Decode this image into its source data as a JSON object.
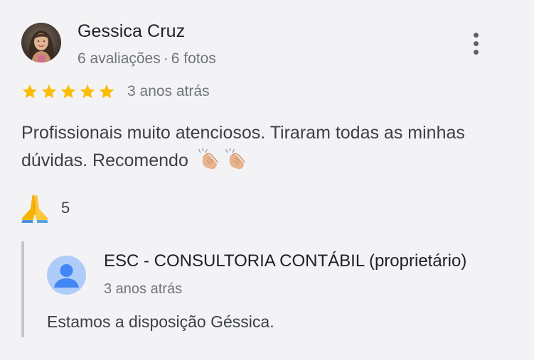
{
  "review": {
    "author": {
      "name": "Gessica Cruz",
      "reviews_count": "6 avaliações",
      "separator": "·",
      "photos_count": "6 fotos"
    },
    "rating": {
      "stars": 5,
      "max_stars": 5,
      "star_color": "#fbbc04",
      "time_ago": "3 anos atrás"
    },
    "text": "Profissionais muito atenciosos. Tiraram todas as minhas dúvidas. Recomendo",
    "text_emojis": [
      "clapping-hands",
      "clapping-hands"
    ],
    "reaction": {
      "icon": "folded-hands",
      "count": "5"
    },
    "menu_icon": "more-vert-icon"
  },
  "owner_reply": {
    "name": "ESC - CONSULTORIA CONTÁBIL (proprietário)",
    "time_ago": "3 anos atrás",
    "text": "Estamos a disposição Géssica.",
    "avatar_color": "#aecbfa",
    "avatar_figure_color": "#4285f4"
  }
}
